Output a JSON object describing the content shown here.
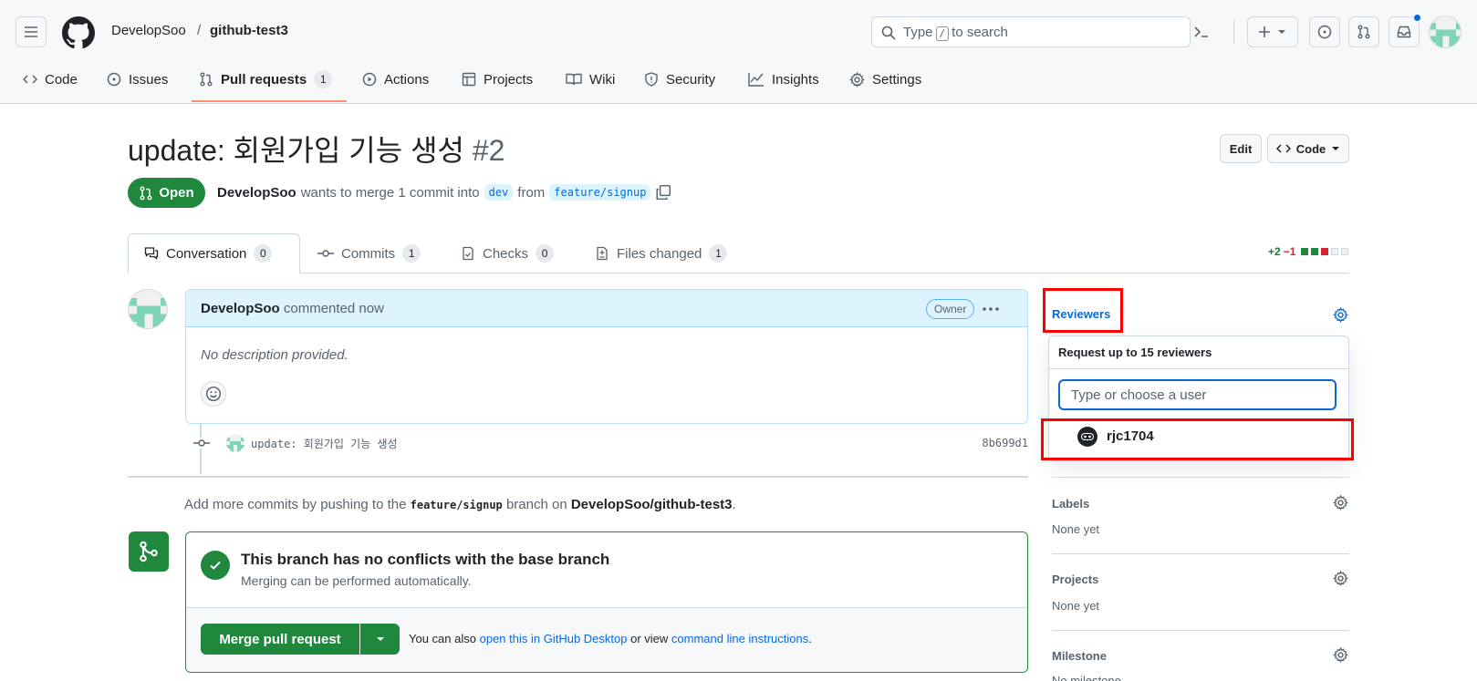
{
  "header": {
    "owner": "DevelopSoo",
    "separator": "/",
    "repo": "github-test3",
    "search": {
      "before": "Type",
      "key": "/",
      "after": "to search"
    }
  },
  "repo_tabs": [
    {
      "label": "Code"
    },
    {
      "label": "Issues"
    },
    {
      "label": "Pull requests",
      "count": "1"
    },
    {
      "label": "Actions"
    },
    {
      "label": "Projects"
    },
    {
      "label": "Wiki"
    },
    {
      "label": "Security"
    },
    {
      "label": "Insights"
    },
    {
      "label": "Settings"
    }
  ],
  "pr": {
    "title": "update: 회원가입 기능 생성",
    "number": "#2",
    "state": "Open",
    "author": "DevelopSoo",
    "merge_text": "wants to merge 1 commit into",
    "base": "dev",
    "from_word": "from",
    "head": "feature/signup",
    "edit_label": "Edit",
    "code_label": "Code"
  },
  "pr_tabs": [
    {
      "label": "Conversation",
      "count": "0"
    },
    {
      "label": "Commits",
      "count": "1"
    },
    {
      "label": "Checks",
      "count": "0"
    },
    {
      "label": "Files changed",
      "count": "1"
    }
  ],
  "diffstat": {
    "added": "+2",
    "removed": "−1"
  },
  "comment": {
    "author": "DevelopSoo",
    "time": "commented now",
    "badge": "Owner",
    "body": "No description provided."
  },
  "commit": {
    "message": "update: 회원가입 기능 생성",
    "sha": "8b699d1"
  },
  "push_note": {
    "prefix": "Add more commits by pushing to the",
    "branch": "feature/signup",
    "middle": "branch on",
    "repo": "DevelopSoo/github-test3",
    "suffix": "."
  },
  "merge": {
    "title": "This branch has no conflicts with the base branch",
    "subtitle": "Merging can be performed automatically.",
    "button": "Merge pull request",
    "alt_prefix": "You can also",
    "alt_link1": "open this in GitHub Desktop",
    "alt_middle": "or view",
    "alt_link2": "command line instructions",
    "alt_suffix": "."
  },
  "sidebar": {
    "reviewers": {
      "label": "Reviewers",
      "popover_title": "Request up to 15 reviewers",
      "placeholder": "Type or choose a user",
      "option": "rjc1704"
    },
    "labels": {
      "label": "Labels",
      "value": "None yet"
    },
    "projects": {
      "label": "Projects",
      "value": "None yet"
    },
    "milestone": {
      "label": "Milestone",
      "value": "No milestone"
    }
  },
  "colors": {
    "accent": "#0969da",
    "success": "#1f883d",
    "danger": "#d1242f",
    "highlight": "#ff0000"
  }
}
